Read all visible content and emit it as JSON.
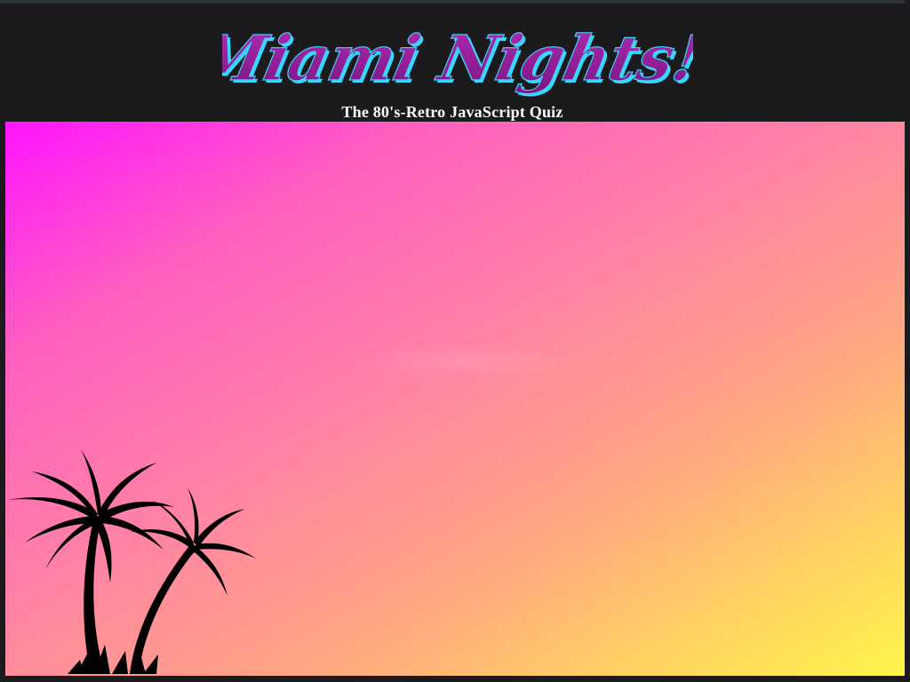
{
  "header": {
    "logo_text": "Miami Nights!",
    "subtitle": "The 80's-Retro JavaScript Quiz"
  },
  "icons": {
    "palm_trees": "palm-trees-icon"
  },
  "colors": {
    "header_bg": "#1b1b1d",
    "logo_fill": "#8e1a8f",
    "logo_outline": "#3ad6ff",
    "gradient_start": "#ff14ff",
    "gradient_end": "#fff54a"
  }
}
